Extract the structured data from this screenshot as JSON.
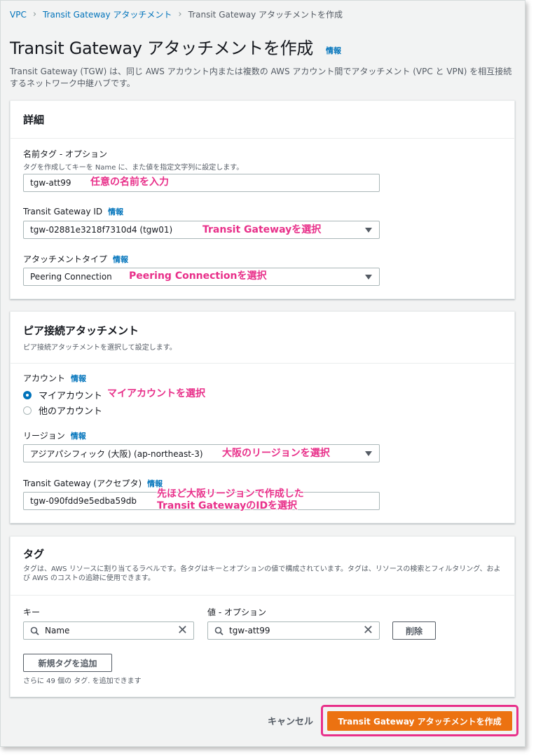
{
  "breadcrumb": {
    "items": [
      "VPC",
      "Transit Gateway アタッチメント",
      "Transit Gateway アタッチメントを作成"
    ]
  },
  "page": {
    "title": "Transit Gateway アタッチメントを作成",
    "info": "情報",
    "description": "Transit Gateway (TGW) は、同じ AWS アカウント内または複数の AWS アカウント間でアタッチメント (VPC と VPN) を相互接続するネットワーク中継ハブです。"
  },
  "details": {
    "title": "詳細",
    "name_tag_label": "名前タグ - オプション",
    "name_tag_hint": "タグを作成してキーを Name に、また値を指定文字列に設定します。",
    "name_tag_value": "tgw-att99",
    "tgw_id_label": "Transit Gateway ID",
    "tgw_id_info": "情報",
    "tgw_id_value": "tgw-02881e3218f7310d4 (tgw01)",
    "attach_type_label": "アタッチメントタイプ",
    "attach_type_info": "情報",
    "attach_type_value": "Peering Connection"
  },
  "peering": {
    "title": "ピア接続アタッチメント",
    "subtitle": "ピア接続アタッチメントを選択して設定します。",
    "account_label": "アカウント",
    "account_info": "情報",
    "account_options": [
      "マイアカウント",
      "他のアカウント"
    ],
    "account_selected": "マイアカウント",
    "region_label": "リージョン",
    "region_info": "情報",
    "region_value": "アジアパシフィック (大阪) (ap-northeast-3)",
    "acceptor_label": "Transit Gateway (アクセプタ)",
    "acceptor_info": "情報",
    "acceptor_value": "tgw-090fdd9e5edba59db"
  },
  "tags": {
    "title": "タグ",
    "description": "タグは、AWS リソースに割り当てるラベルです。各タグはキーとオプションの値で構成されています。タグは、リソースの検索とフィルタリング、および AWS のコストの追跡に使用できます。",
    "key_header": "キー",
    "value_header": "値 - オプション",
    "key_value": "Name",
    "value_value": "tgw-att99",
    "remove_label": "削除",
    "add_label": "新規タグを追加",
    "remaining": "さらに 49 個の タグ. を追加できます"
  },
  "footer": {
    "cancel_label": "キャンセル",
    "create_label": "Transit Gateway アタッチメントを作成"
  },
  "annotations": {
    "name": "任意の名前を入力",
    "tgw": "Transit Gatewayを選択",
    "peering": "Peering Connectionを選択",
    "account": "マイアカウントを選択",
    "region": "大阪のリージョンを選択",
    "acceptor_line1": "先ほど大阪リージョンで作成した",
    "acceptor_line2": "Transit GatewayのIDを選択"
  },
  "colors": {
    "link": "#0073bb",
    "primary_button": "#ec7211",
    "annotation": "#e8308a"
  }
}
